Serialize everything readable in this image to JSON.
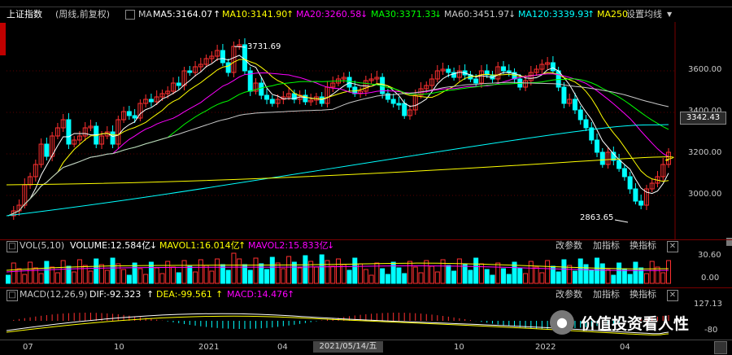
{
  "header": {
    "title": "上证指数",
    "subtitle": "(周线,前复权)",
    "ma_icon": "checkbox-icon",
    "ma_label": "MA",
    "ma_items": [
      {
        "label": "MA5:3164.07",
        "arrow": "↑",
        "color": "#ffffff"
      },
      {
        "label": "MA10:3141.90",
        "arrow": "↑",
        "color": "#ffff00"
      },
      {
        "label": "MA20:3260.58",
        "arrow": "↓",
        "color": "#ff00ff"
      },
      {
        "label": "MA30:3371.33",
        "arrow": "↓",
        "color": "#00ff00"
      },
      {
        "label": "MA60:3451.97",
        "arrow": "↓",
        "color": "#c8c8c8"
      },
      {
        "label": "MA120:3339.93",
        "arrow": "↑",
        "color": "#00ffff"
      },
      {
        "label": "MA250",
        "arrow": "",
        "color": "#ffff00"
      }
    ],
    "settings_label": "设置均线",
    "settings_icon": "chevron-down-icon"
  },
  "main_chart": {
    "price_axis": [
      "3600.00",
      "3400.00",
      "3200.00",
      "3000.00"
    ],
    "current_price": "3342.43",
    "high_label": "3731.69",
    "low_label": "2863.65",
    "colors": {
      "up": "#ff3030",
      "down": "#00ffff",
      "ma5": "#ffffff",
      "ma10": "#ffff00",
      "ma20": "#ff00ff",
      "ma30": "#00ff00",
      "ma60": "#c8c8c8",
      "ma120": "#00ffff",
      "ma250": "#ffff00"
    }
  },
  "vol_panel": {
    "title": "VOL(5,10)",
    "volume": "VOLUME:12.584亿",
    "volume_arrow": "↓",
    "mavol1": "MAVOL1:16.014亿",
    "mavol1_arrow": "↑",
    "mavol2": "MAVOL2:15.833亿",
    "mavol2_arrow": "↓",
    "axis": [
      "30.60",
      "0.00"
    ],
    "buttons": [
      "改参数",
      "加指标",
      "换指标"
    ],
    "close_icon": "close-icon"
  },
  "macd_panel": {
    "title": "MACD(12,26,9)",
    "dif": "DIF:-92.323",
    "dif_arrow": "↑",
    "dea": "DEA:-99.561",
    "dea_arrow": "↑",
    "macd": "MACD:14.476",
    "macd_arrow": "↑",
    "axis": [
      "127.13",
      "-80"
    ],
    "buttons": [
      "改参数",
      "加指标",
      "换指标"
    ],
    "close_icon": "close-icon"
  },
  "x_axis": {
    "labels": [
      "07",
      "10",
      "2021",
      "04",
      "2021/05/14/五",
      "10",
      "2022",
      "04"
    ],
    "selected_date": "2021/05/14/五"
  },
  "watermark": {
    "icon": "wechat-icon",
    "text": "价值投资看人性"
  }
}
